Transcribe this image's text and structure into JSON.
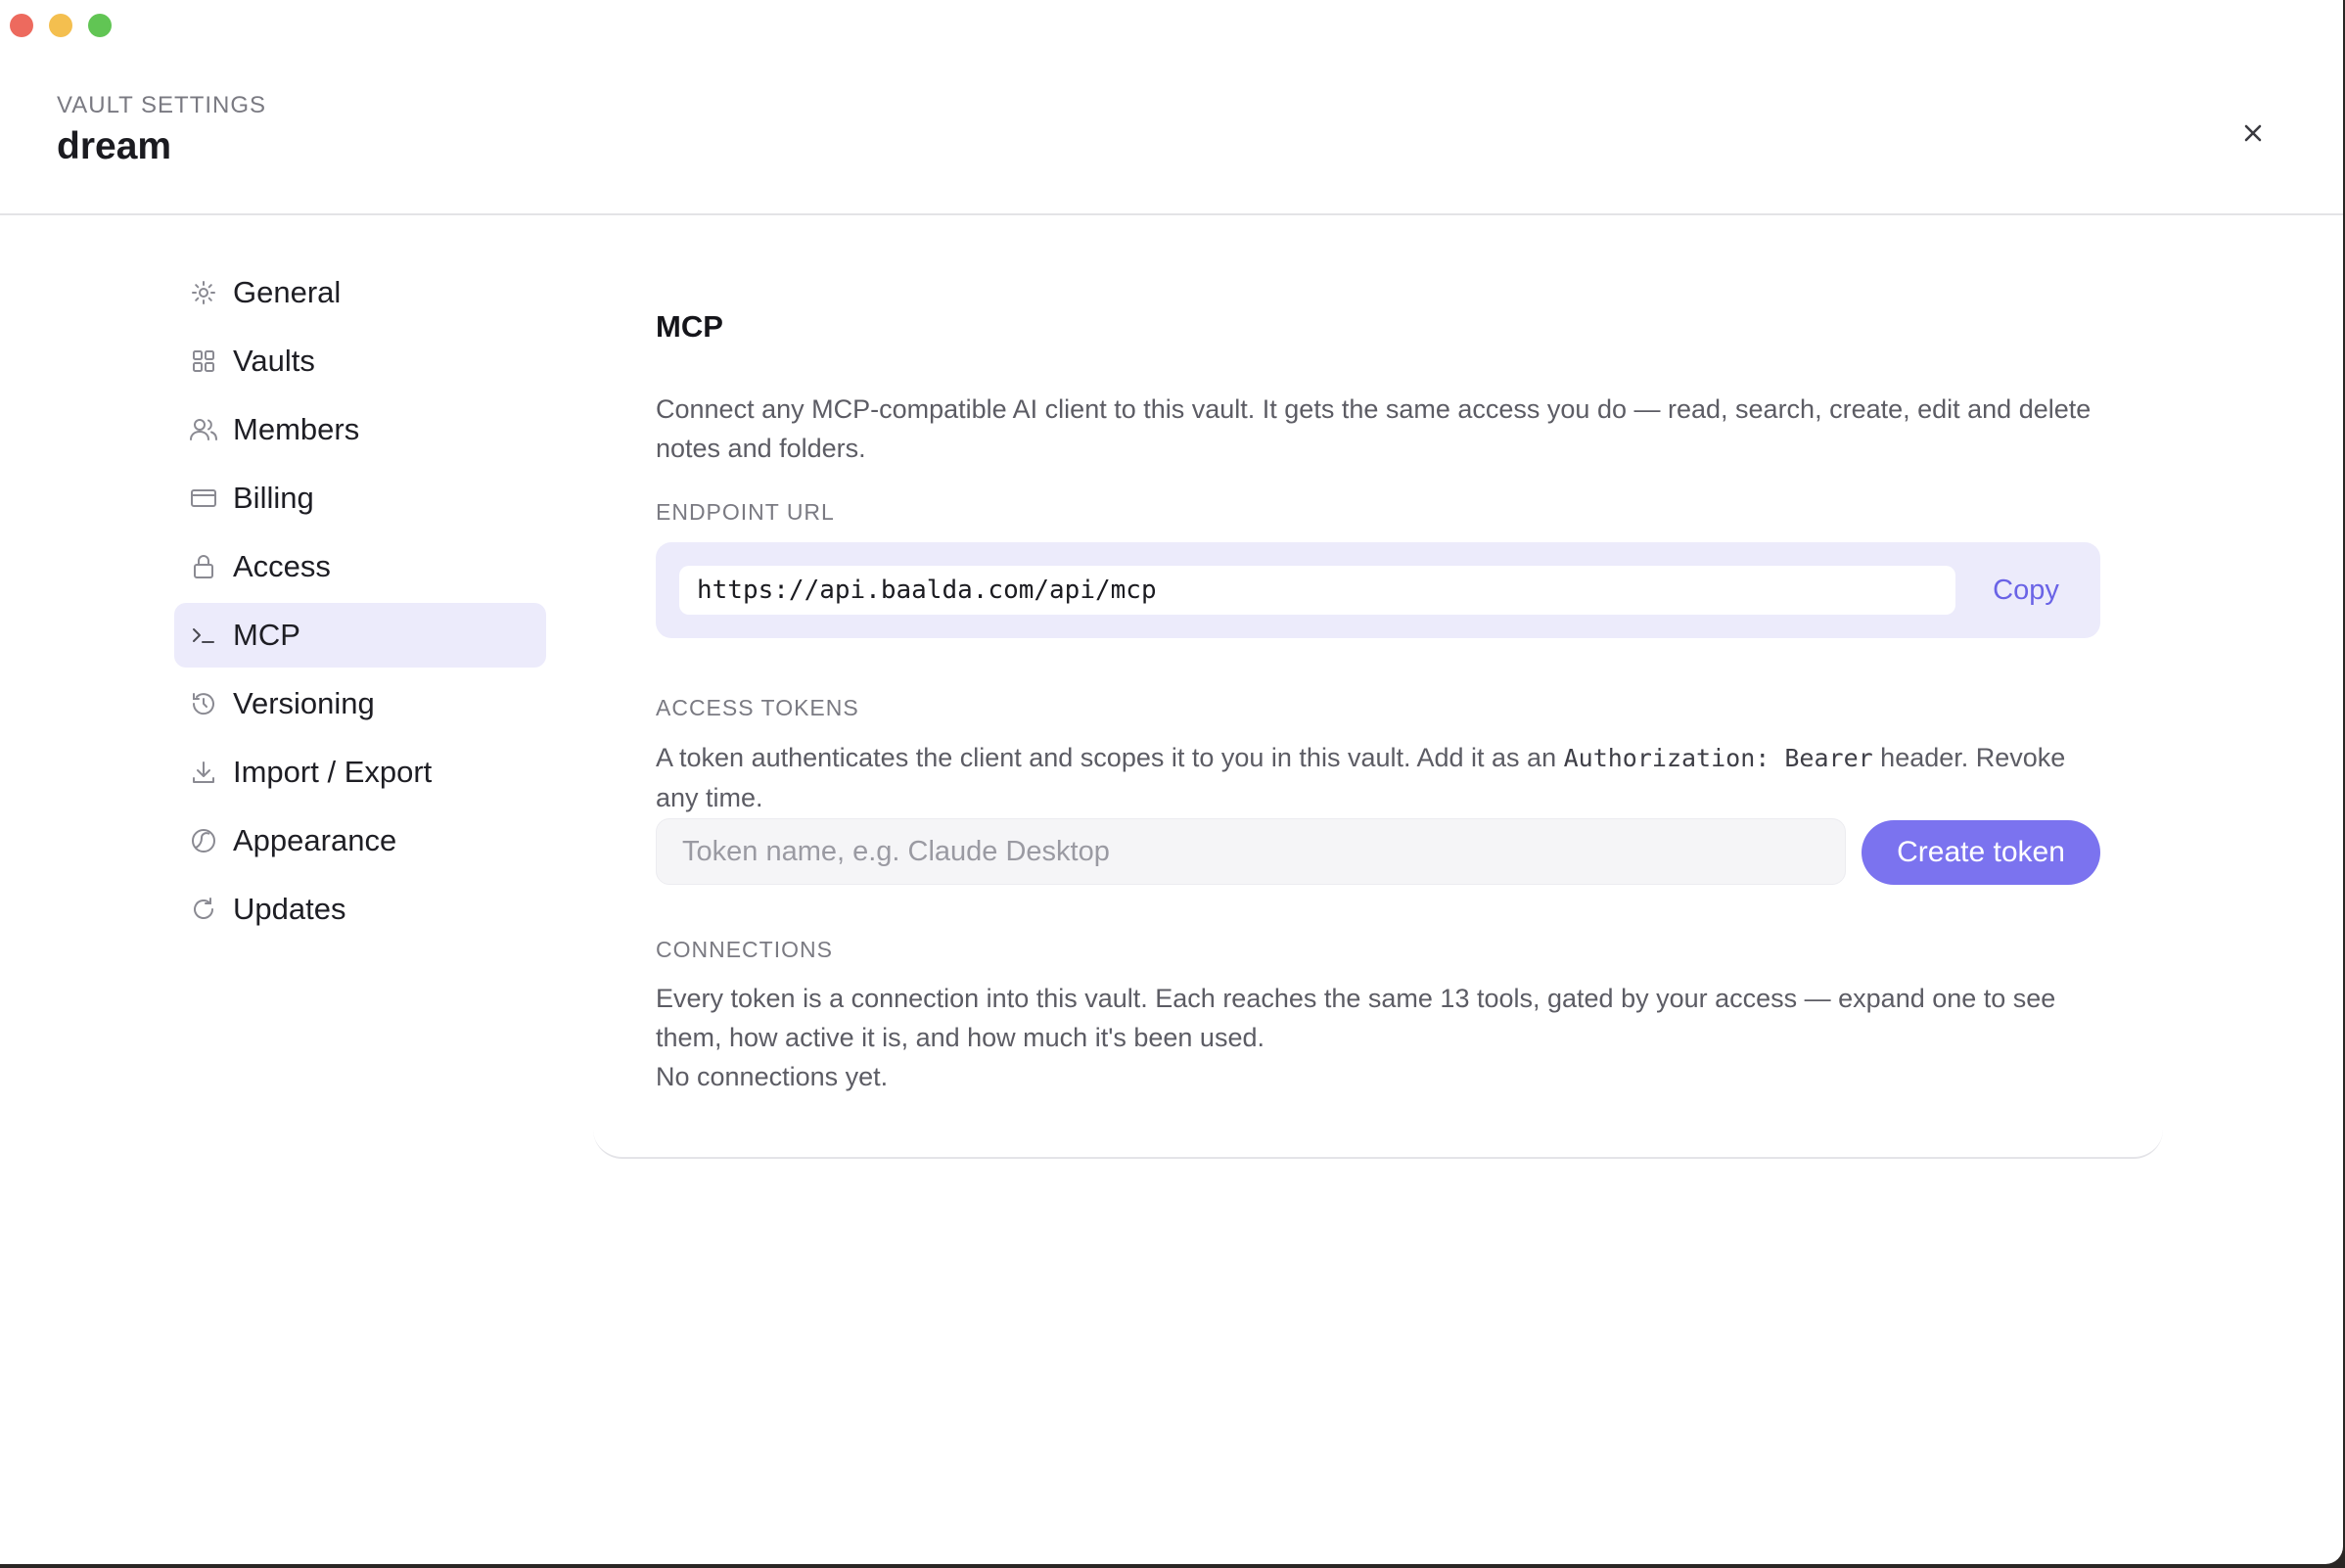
{
  "window": {
    "traffic_lights": [
      {
        "name": "close-window",
        "color": "#ed6a5e"
      },
      {
        "name": "minimize-window",
        "color": "#f4bf4f"
      },
      {
        "name": "zoom-window",
        "color": "#61c554"
      }
    ]
  },
  "header": {
    "eyebrow": "VAULT SETTINGS",
    "title": "dream",
    "close_icon": "close-icon"
  },
  "sidebar": {
    "items": [
      {
        "label": "General",
        "icon": "gear-icon",
        "active": false
      },
      {
        "label": "Vaults",
        "icon": "grid-icon",
        "active": false
      },
      {
        "label": "Members",
        "icon": "users-icon",
        "active": false
      },
      {
        "label": "Billing",
        "icon": "credit-card-icon",
        "active": false
      },
      {
        "label": "Access",
        "icon": "lock-icon",
        "active": false
      },
      {
        "label": "MCP",
        "icon": "terminal-icon",
        "active": true
      },
      {
        "label": "Versioning",
        "icon": "history-icon",
        "active": false
      },
      {
        "label": "Import / Export",
        "icon": "download-icon",
        "active": false
      },
      {
        "label": "Appearance",
        "icon": "palette-icon",
        "active": false
      },
      {
        "label": "Updates",
        "icon": "refresh-icon",
        "active": false
      }
    ]
  },
  "mcp": {
    "title": "MCP",
    "intro": "Connect any MCP-compatible AI client to this vault. It gets the same access you do — read, search, create, edit and delete notes and folders.",
    "endpoint": {
      "label": "ENDPOINT URL",
      "url": "https://api.baalda.com/api/mcp",
      "copy_label": "Copy"
    },
    "tokens": {
      "label": "ACCESS TOKENS",
      "desc_before": "A token authenticates the client and scopes it to you in this vault. Add it as an ",
      "desc_code": "Authorization: Bearer",
      "desc_after": " header. Revoke any time.",
      "input_value": "",
      "input_placeholder": "Token name, e.g. Claude Desktop",
      "create_label": "Create token"
    },
    "connections": {
      "label": "CONNECTIONS",
      "desc": "Every token is a connection into this vault. Each reaches the same 13 tools, gated by your access — expand one to see them, how active it is, and how much it's been used.",
      "empty": "No connections yet."
    }
  },
  "colors": {
    "accent": "#7b73ef",
    "accent_text": "#6a63e6",
    "active_bg": "#ecebfb"
  }
}
